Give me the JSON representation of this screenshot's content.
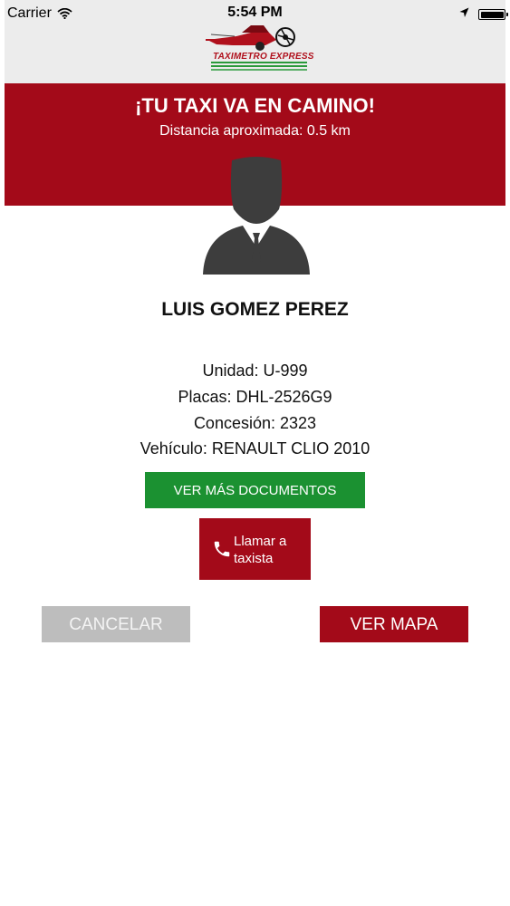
{
  "status_bar": {
    "carrier": "Carrier",
    "time": "5:54 PM",
    "battery_level": 1.0
  },
  "brand": {
    "logo_text": "TAXIMETRO EXPRESS"
  },
  "banner": {
    "title": "¡TU TAXI VA EN CAMINO!",
    "subtitle": "Distancia aproximada: 0.5 km"
  },
  "driver": {
    "name": "LUIS GOMEZ PEREZ",
    "unit": "Unidad: U-999",
    "plates": "Placas: DHL-2526G9",
    "concession": "Concesión: 2323",
    "vehicle": "Vehículo: RENAULT CLIO 2010"
  },
  "actions": {
    "documents_label": "VER MÁS DOCUMENTOS",
    "call_label": "Llamar a taxista",
    "cancel_label": "CANCELAR",
    "map_label": "VER MAPA"
  },
  "colors": {
    "brand_red": "#a30a19",
    "green": "#1b9131",
    "gray": "#bdbdbd",
    "header_gray": "#ececec"
  },
  "icons": {
    "wifi": "wifi-icon",
    "location": "location-arrow-icon",
    "battery": "battery-icon",
    "phone": "phone-icon",
    "avatar": "driver-avatar-icon"
  }
}
